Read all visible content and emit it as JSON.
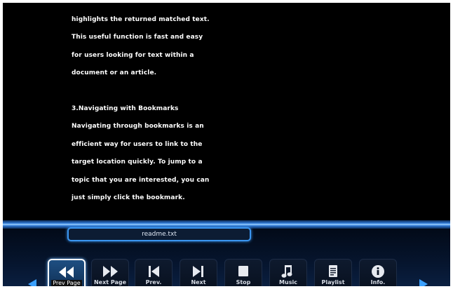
{
  "document": {
    "lines": [
      "highlights the returned matched text.",
      "This useful function is fast and easy",
      "for users looking for text within a",
      "document or an article.",
      "",
      "3.Navigating with Bookmarks",
      "Navigating through bookmarks is an",
      "efficient way for users to link to the",
      "target location quickly. To jump to a",
      "topic that you are interested, you can",
      "just simply click the bookmark."
    ]
  },
  "file": {
    "name": "readme.txt"
  },
  "toolbar": {
    "buttons": [
      {
        "label": "Prev Page",
        "icon": "rewind-icon",
        "selected": true
      },
      {
        "label": "Next Page",
        "icon": "fast-forward-icon",
        "selected": false
      },
      {
        "label": "Prev.",
        "icon": "skip-previous-icon",
        "selected": false
      },
      {
        "label": "Next",
        "icon": "skip-next-icon",
        "selected": false
      },
      {
        "label": "Stop",
        "icon": "stop-icon",
        "selected": false
      },
      {
        "label": "Music",
        "icon": "music-note-icon",
        "selected": false
      },
      {
        "label": "Playlist",
        "icon": "playlist-icon",
        "selected": false
      },
      {
        "label": "Info.",
        "icon": "info-icon",
        "selected": false
      }
    ]
  },
  "colors": {
    "accent": "#3aa0ff",
    "background": "#000000",
    "text": "#ffffff"
  }
}
